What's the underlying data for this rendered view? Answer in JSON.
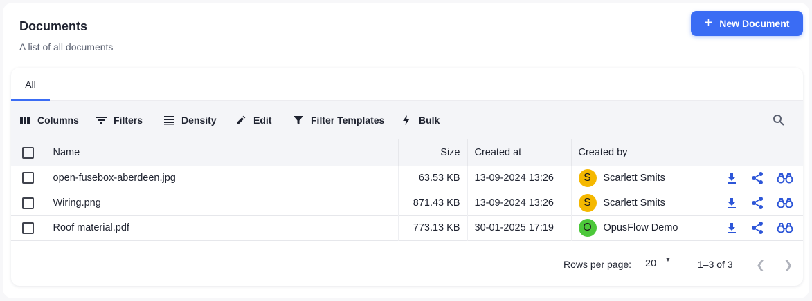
{
  "header": {
    "title": "Documents",
    "subtitle": "A list of all documents",
    "new_button_label": "New Document"
  },
  "tabs": [
    {
      "label": "All",
      "active": true
    }
  ],
  "toolbar": {
    "columns": "Columns",
    "filters": "Filters",
    "density": "Density",
    "edit": "Edit",
    "filter_templates": "Filter Templates",
    "bulk": "Bulk"
  },
  "table": {
    "headers": {
      "name": "Name",
      "size": "Size",
      "created_at": "Created at",
      "created_by": "Created by"
    },
    "rows": [
      {
        "name": "open-fusebox-aberdeen.jpg",
        "size": "63.53 KB",
        "created_at": "13-09-2024 13:26",
        "initial": "S",
        "created_by": "Scarlett Smits",
        "avatar_color": "#f5b800"
      },
      {
        "name": "Wiring.png",
        "size": "871.43 KB",
        "created_at": "13-09-2024 13:26",
        "initial": "S",
        "created_by": "Scarlett Smits",
        "avatar_color": "#f5b800"
      },
      {
        "name": "Roof material.pdf",
        "size": "773.13 KB",
        "created_at": "30-01-2025 17:19",
        "initial": "O",
        "created_by": "OpusFlow Demo",
        "avatar_color": "#4cc83a"
      }
    ]
  },
  "pagination": {
    "rows_per_page_label": "Rows per page:",
    "rows_per_page": "20",
    "range": "1–3 of 3"
  },
  "colors": {
    "accent": "#3a6cf4",
    "action_icon": "#2d56d8"
  },
  "icons": [
    "plus-icon",
    "columns-icon",
    "filter-lines-icon",
    "density-icon",
    "pencil-icon",
    "funnel-icon",
    "bolt-icon",
    "search-icon",
    "download-icon",
    "share-icon",
    "binoculars-icon",
    "chevron-left-icon",
    "chevron-right-icon",
    "caret-down-icon"
  ]
}
